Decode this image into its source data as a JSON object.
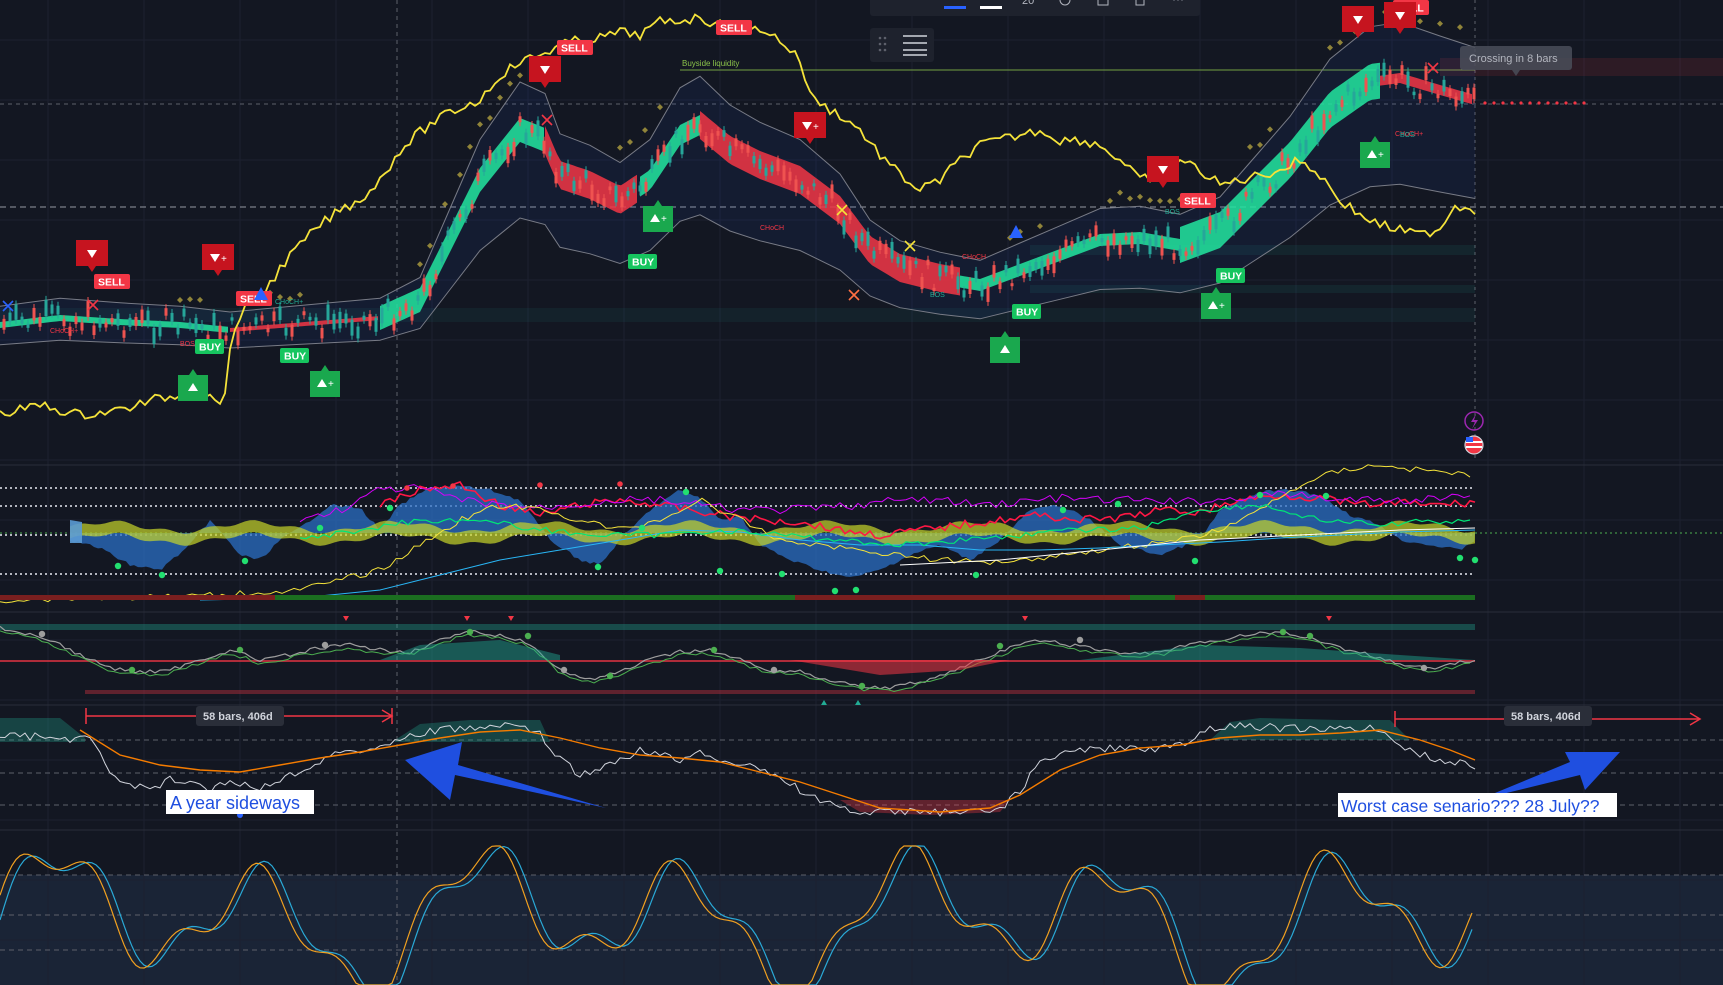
{
  "toolbar": {
    "zoom_value": "20",
    "menu_icon": "hamburger-icon"
  },
  "annotations": {
    "tooltip": "Crossing in 8 bars",
    "range_left": "58 bars, 406d",
    "range_right": "58 bars, 406d",
    "note_left": "A year sideways",
    "note_right": "Worst case senario??? 28 July??",
    "liquidity_label": "Buyside liquidity"
  },
  "colors": {
    "background": "#131722",
    "price_yellow": "#f5e33a",
    "ema_green": "#22e6a0",
    "ema_red": "#f23645",
    "buy_green": "#1aa84e",
    "sell_red": "#c6141f",
    "arrow_blue": "#1f4fe0",
    "osc_blue": "#2b6fc4",
    "stoch_blue": "#2aa9d6",
    "stoch_orange": "#f0a020"
  },
  "chart_data": [
    {
      "type": "line",
      "panel": "price",
      "signals": [
        {
          "kind": "sell",
          "label": "SELL",
          "bar": 8
        },
        {
          "kind": "sell",
          "label": "SELL",
          "bar": 20
        },
        {
          "kind": "buy",
          "label": "BUY",
          "bar": 16
        },
        {
          "kind": "buy",
          "label": "BUY",
          "bar": 24
        },
        {
          "kind": "sell",
          "label": "SELL",
          "bar": 46
        },
        {
          "kind": "sell",
          "label": "SELL",
          "bar": 60
        },
        {
          "kind": "buy",
          "label": "BUY",
          "bar": 53
        },
        {
          "kind": "buy",
          "label": "BUY",
          "bar": 86
        },
        {
          "kind": "sell",
          "label": "SELL",
          "bar": 101
        },
        {
          "kind": "buy",
          "label": "BUY",
          "bar": 104
        },
        {
          "kind": "sell",
          "label": "SELL",
          "bar": 119
        }
      ],
      "small_labels": [
        "BOS",
        "CHoCH+",
        "CHoCH",
        "BOS",
        "CHoCH",
        "BOS",
        "CHoCH+",
        "BOS",
        "CHoCH+"
      ]
    },
    {
      "type": "area",
      "panel": "oscillator"
    },
    {
      "type": "line",
      "panel": "stochastic"
    }
  ]
}
